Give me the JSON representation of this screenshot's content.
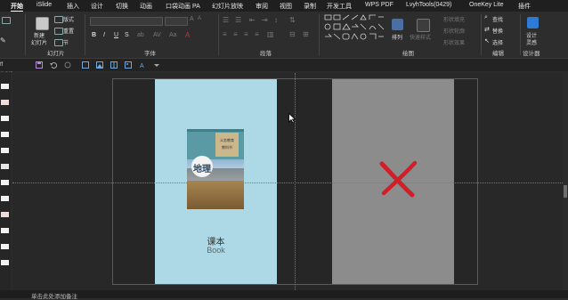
{
  "tabs": [
    "开始",
    "iSlide",
    "插入",
    "设计",
    "切换",
    "动画",
    "口袋动画 PA",
    "幻灯片放映",
    "审阅",
    "视图",
    "录制",
    "开发工具",
    "WPS PDF",
    "LvyhTools(0429)",
    "OneKey Lite",
    "插件"
  ],
  "ribbon": {
    "format_painter": "格式刷",
    "slides": {
      "new_slide_l1": "新建",
      "new_slide_l2": "幻灯片",
      "layout": "版式",
      "reset": "重置",
      "section": "节"
    },
    "groups": {
      "slides": "幻灯片",
      "font": "字体",
      "paragraph": "段落",
      "drawing": "绘图",
      "editing": "编辑",
      "designer": "设计器"
    },
    "arrange": "排列",
    "quick_styles": "快速样式",
    "shape_fill": "形状填充",
    "shape_outline": "形状轮廓",
    "shape_effects": "形状效果",
    "find": "查找",
    "replace": "替换",
    "select": "选择",
    "designer_l1": "设计",
    "designer_l2": "灵感",
    "font_letters": [
      "B",
      "I",
      "U",
      "S"
    ]
  },
  "slide": {
    "book": {
      "label_line1": "义务教育",
      "label_line2": "教科书",
      "title": "地理"
    },
    "caption_cn": "课本",
    "caption_en": "Book"
  },
  "notes_placeholder": "单击此处添加备注",
  "colors": {
    "blue_panel": "#add8e6",
    "gray_panel": "#8c8c8c",
    "cross": "#d11f2a"
  }
}
